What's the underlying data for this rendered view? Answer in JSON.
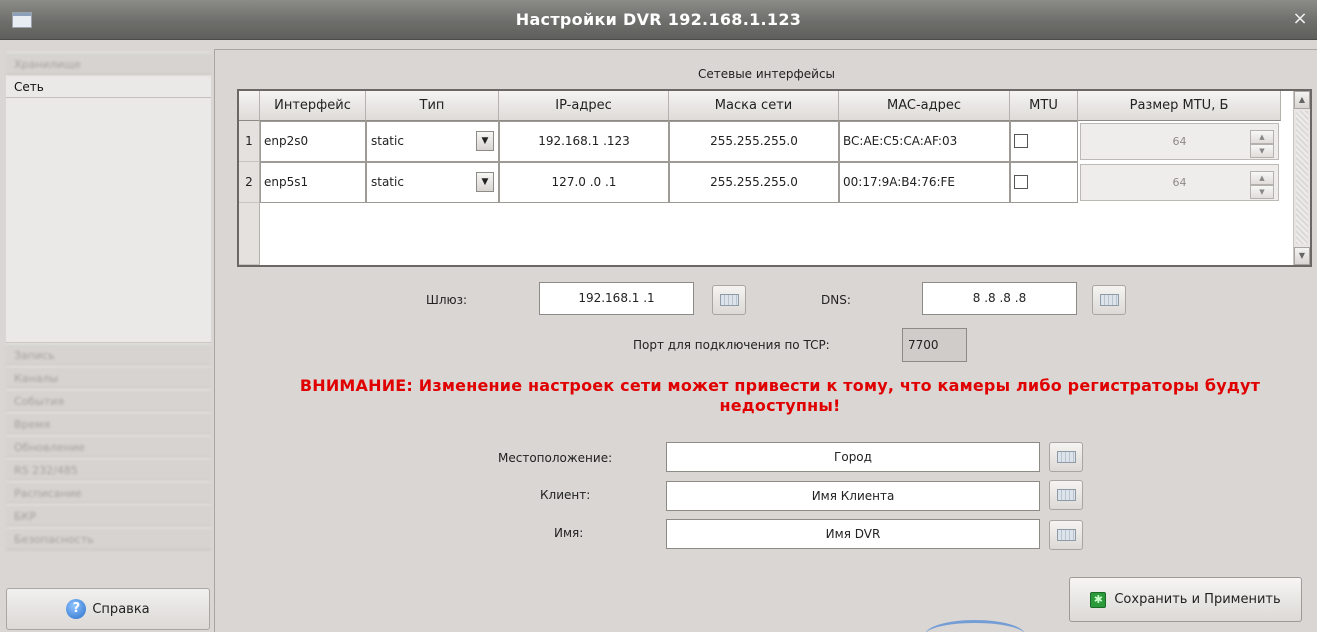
{
  "window": {
    "title": "Настройки DVR 192.168.1.123",
    "close_glyph": "×"
  },
  "sidebar": {
    "top_items": [
      {
        "label": "Хранилище",
        "blurred": true
      },
      {
        "label": "Сеть",
        "active": true
      }
    ],
    "bottom_items": [
      {
        "label": "Запись"
      },
      {
        "label": "Каналы"
      },
      {
        "label": "События"
      },
      {
        "label": "Время"
      },
      {
        "label": "Обновление"
      },
      {
        "label": "RS 232/485"
      },
      {
        "label": "Расписание"
      },
      {
        "label": "БКР"
      },
      {
        "label": "Безопасность"
      }
    ],
    "help_label": "Справка",
    "help_icon": "?"
  },
  "network": {
    "caption": "Сетевые интерфейсы",
    "headers": [
      "Интерфейс",
      "Тип",
      "IP-адрес",
      "Маска сети",
      "MAC-адрес",
      "MTU",
      "Размер MTU, Б"
    ],
    "rows": [
      {
        "num": "1",
        "iface": "enp2s0",
        "type": "static",
        "ip": "192.168.1 .123",
        "mask": "255.255.255.0",
        "mac": "BC:AE:C5:CA:AF:03",
        "mtu_checked": false,
        "mtu_size": "64"
      },
      {
        "num": "2",
        "iface": "enp5s1",
        "type": "static",
        "ip": "127.0 .0 .1",
        "mask": "255.255.255.0",
        "mac": "00:17:9A:B4:76:FE",
        "mtu_checked": false,
        "mtu_size": "64"
      }
    ]
  },
  "gateway": {
    "label": "Шлюз:",
    "value": "192.168.1 .1"
  },
  "dns": {
    "label": "DNS:",
    "value": "8 .8 .8 .8"
  },
  "tcp_port": {
    "label": "Порт для подключения по TCP:",
    "value": "7700"
  },
  "warning": "ВНИМАНИЕ: Изменение настроек сети может привести к тому, что камеры либо регистраторы будут недоступны!",
  "location": {
    "label": "Местоположение:",
    "value": "Город"
  },
  "client": {
    "label": "Клиент:",
    "value": "Имя Клиента"
  },
  "name": {
    "label": "Имя:",
    "value": "Имя DVR"
  },
  "save_label": "Сохранить и Применить"
}
